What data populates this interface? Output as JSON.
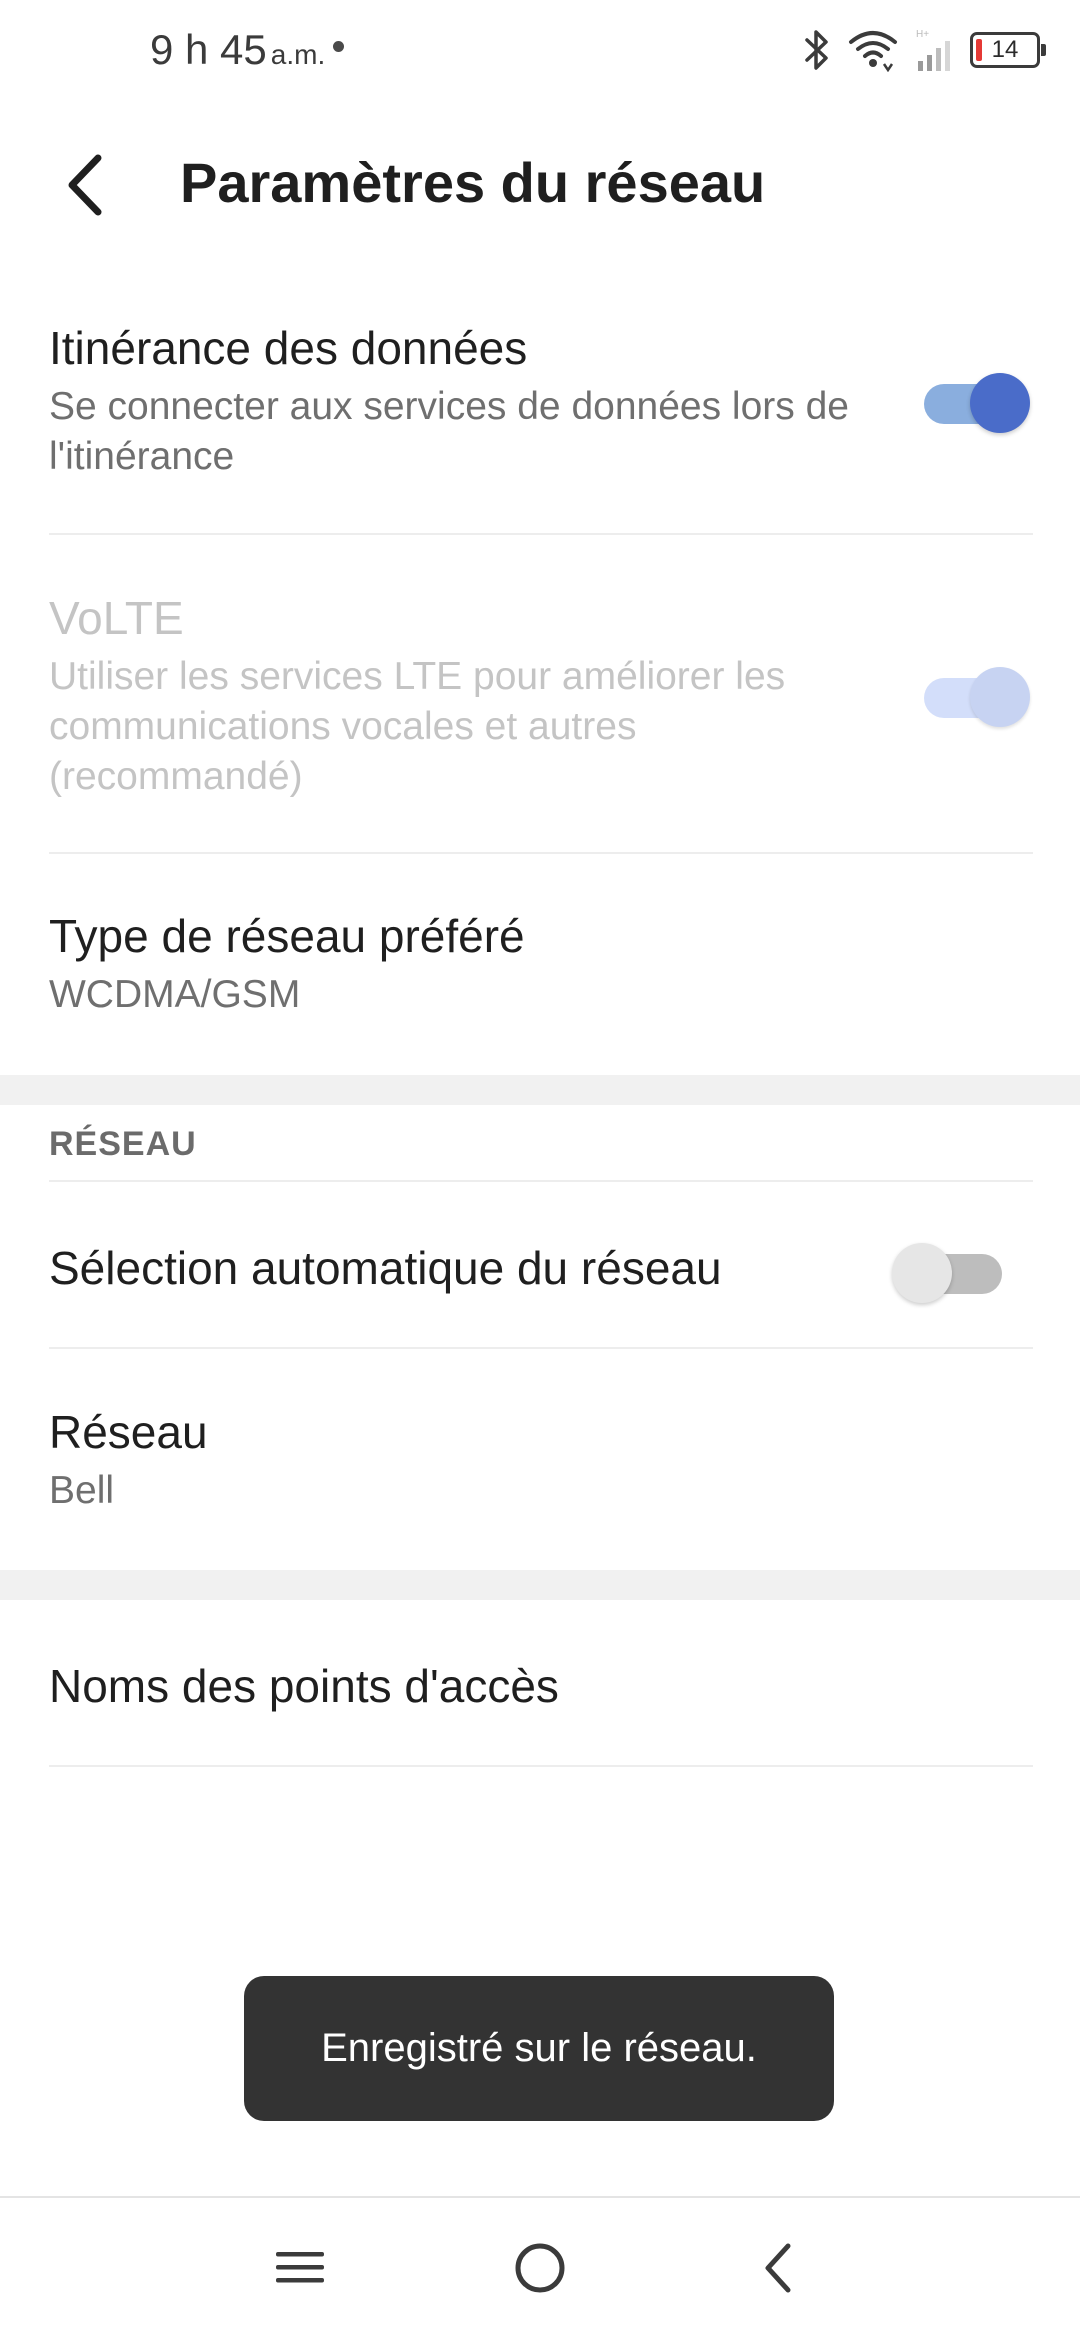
{
  "status_bar": {
    "time": "9 h 45",
    "ampm": "a.m.",
    "battery_level": "14"
  },
  "header": {
    "title": "Paramètres du réseau"
  },
  "settings": {
    "data_roaming": {
      "title": "Itinérance des données",
      "subtitle": "Se connecter aux services de données lors de l'itinérance",
      "enabled": true
    },
    "volte": {
      "title": "VoLTE",
      "subtitle": "Utiliser les services LTE pour améliorer les communications vocales et autres (recommandé)",
      "enabled": true,
      "disabled": true
    },
    "preferred_network_type": {
      "title": "Type de réseau préféré",
      "value": "WCDMA/GSM"
    }
  },
  "network_section": {
    "header": "RÉSEAU",
    "auto_select": {
      "title": "Sélection automatique du réseau",
      "enabled": false
    },
    "network": {
      "title": "Réseau",
      "value": "Bell"
    }
  },
  "apn": {
    "title": "Noms des points d'accès"
  },
  "toast": {
    "message": "Enregistré sur le réseau."
  },
  "colors": {
    "accent": "#4a6cc9",
    "accent_track": "#8aaede",
    "toast_bg": "#333333"
  }
}
